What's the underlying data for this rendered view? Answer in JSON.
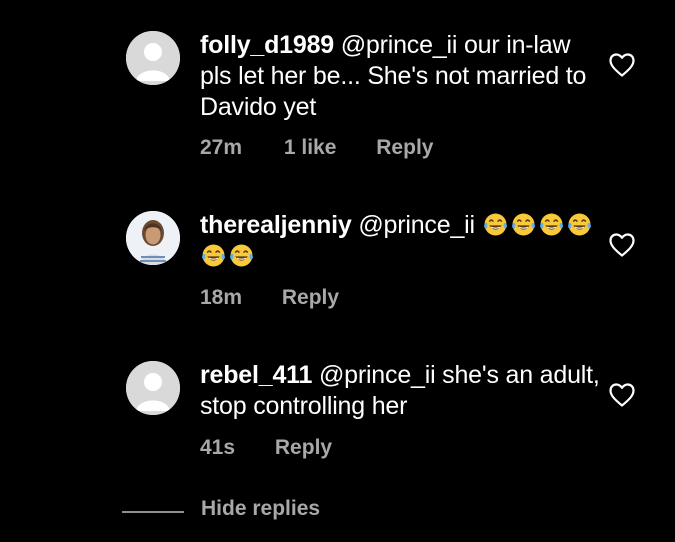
{
  "comments": [
    {
      "username": "folly_d1989",
      "text": " @prince_ii our in-law pls let her be... She's not married to Davido yet",
      "time": "27m",
      "likes": "1 like",
      "reply": "Reply",
      "avatar": "default-avatar"
    },
    {
      "username": "therealjenniy",
      "text": " @prince_ii ",
      "emoji_icon": "face-with-tears-of-joy",
      "emoji_count": 6,
      "time": "18m",
      "reply": "Reply",
      "avatar": "profile-photo"
    },
    {
      "username": "rebel_411",
      "text": " @prince_ii she's an adult, stop controlling her",
      "time": "41s",
      "reply": "Reply",
      "avatar": "default-avatar"
    }
  ],
  "hide_replies": "Hide replies",
  "colors": {
    "background": "#000000",
    "text": "#ffffff",
    "muted": "#a8a8a8",
    "avatar_placeholder": "#d9d9d9"
  }
}
